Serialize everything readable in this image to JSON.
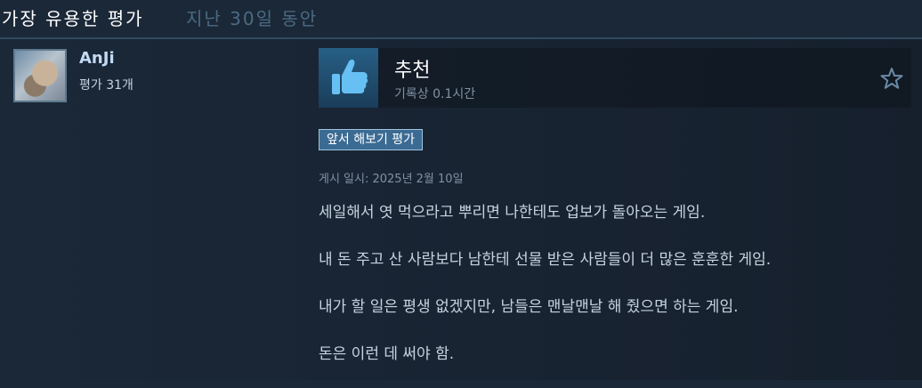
{
  "header": {
    "title": "가장 유용한 평가",
    "period": "지난 30일 동안"
  },
  "review": {
    "author": {
      "name": "AnJi",
      "review_count": "평가 31개"
    },
    "recommendation": {
      "label": "추천",
      "hours": "기록상 0.1시간",
      "icon": "thumbs-up-icon"
    },
    "early_access_tag": "앞서 해보기 평가",
    "posted_date": "게시 일시: 2025년 2월 10일",
    "paragraphs": [
      "세일해서 엿 먹으라고 뿌리면 나한테도 업보가 돌아오는 게임.",
      "내 돈 주고 산 사람보다 남한테 선물 받은 사람들이 더 많은 훈훈한 게임.",
      "내가 할 일은 평생 없겠지만, 남들은 맨날맨날 해 줬으면 하는 게임.",
      "돈은 이런 데 써야 함."
    ]
  },
  "colors": {
    "background": "#1b2838",
    "accent_blue": "#c1dbf4",
    "tag_bg": "#3b6b93"
  }
}
